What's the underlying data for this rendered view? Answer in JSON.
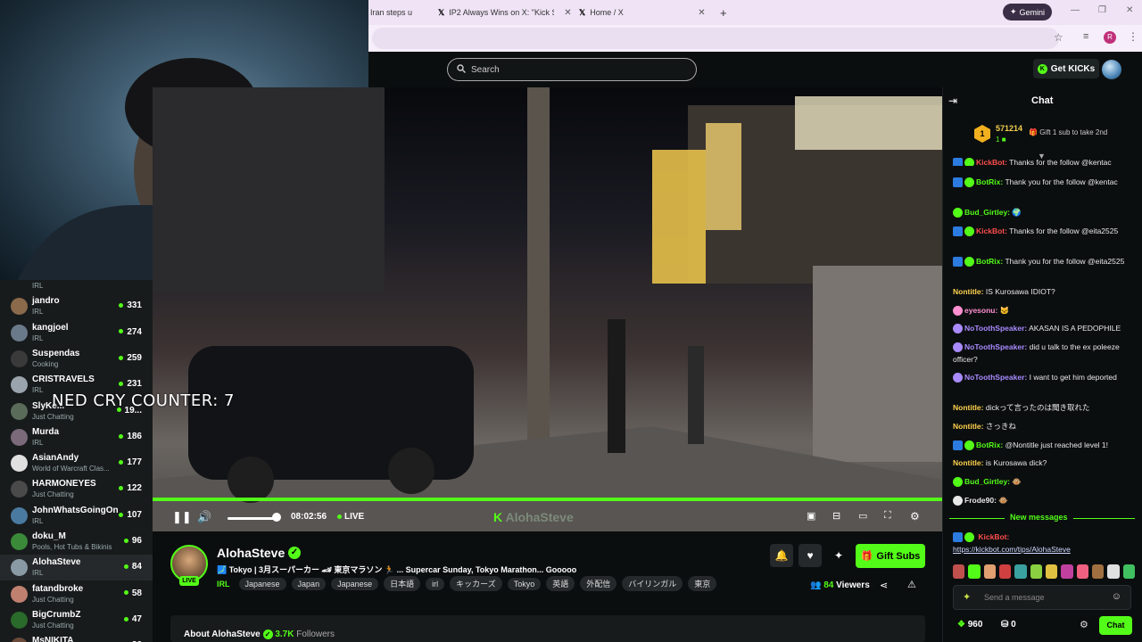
{
  "browser": {
    "tabs": [
      {
        "label": "Iran steps u"
      },
      {
        "label": "IP2 Always Wins on X: \"Kick Stre"
      },
      {
        "label": "Home / X"
      }
    ],
    "gemini_label": "Gemini",
    "profile_initial": "R"
  },
  "header": {
    "search_placeholder": "Search",
    "get_kicks_label": "Get KICKs"
  },
  "overlay": {
    "counter_text": "NED CRY COUNTER: 7"
  },
  "player": {
    "time": "08:02:56",
    "live_label": "LIVE",
    "watermark": "AlohaSteve",
    "progress_fraction": 1.0
  },
  "sidebar": {
    "channels": [
      {
        "name": "",
        "category": "IRL",
        "viewers": ""
      },
      {
        "name": "jandro",
        "category": "IRL",
        "viewers": "331",
        "color": "#8a6a4a"
      },
      {
        "name": "kangjoel",
        "category": "IRL",
        "viewers": "274",
        "color": "#6a7a8a"
      },
      {
        "name": "Suspendas",
        "category": "Cooking",
        "viewers": "259",
        "color": "#3a3a3a"
      },
      {
        "name": "CRISTRAVELS",
        "category": "IRL",
        "viewers": "231",
        "color": "#9aa4ad"
      },
      {
        "name": "SlyKe...",
        "category": "Just Chatting",
        "viewers": "19...",
        "color": "#5b6b5a"
      },
      {
        "name": "Murda",
        "category": "IRL",
        "viewers": "186",
        "color": "#7a6a7a"
      },
      {
        "name": "AsianAndy",
        "category": "World of Warcraft Clas...",
        "viewers": "177",
        "color": "#e0e0e0"
      },
      {
        "name": "HARMONEYES",
        "category": "Just Chatting",
        "viewers": "122",
        "color": "#4a4a4a"
      },
      {
        "name": "JohnWhatsGoingOn",
        "category": "IRL",
        "viewers": "107",
        "color": "#4a7aa0"
      },
      {
        "name": "doku_M",
        "category": "Pools, Hot Tubs & Bikinis",
        "viewers": "96",
        "color": "#3a8a3a"
      },
      {
        "name": "AlohaSteve",
        "category": "IRL",
        "viewers": "84",
        "color": "#8a9aa4"
      },
      {
        "name": "fatandbroke",
        "category": "Just Chatting",
        "viewers": "58",
        "color": "#c08070"
      },
      {
        "name": "BigCrumbZ",
        "category": "Just Chatting",
        "viewers": "47",
        "color": "#2a6a2a"
      },
      {
        "name": "MsNIKITA",
        "category": "",
        "viewers": "36",
        "color": "#6a4a3a"
      }
    ]
  },
  "stream": {
    "streamer": "AlohaSteve",
    "live_badge": "LIVE",
    "title": "🗾 Tokyo | 3月スーパーカー 🏎 東京マラソン 🏃 ... Supercar Sunday, Tokyo Marathon... Gooooo",
    "category": "IRL",
    "tags": [
      "Japanese",
      "Japan",
      "Japanese",
      "日本語",
      "irl",
      "キッカーズ",
      "Tokyo",
      "英語",
      "外配信",
      "バイリンガル",
      "東京"
    ],
    "viewers_count": "84",
    "viewers_label": "Viewers",
    "gift_subs_label": "Gift Subs",
    "about_label": "About AlohaSteve",
    "followers_count": "3.7K",
    "followers_label": "Followers"
  },
  "chat": {
    "title": "Chat",
    "pinned_gifter_count": "571214",
    "pinned_gifter_sub": "1",
    "gift_prompt": "Gift 1 sub to take 2nd",
    "messages": [
      {
        "user": "KickBot:",
        "text": "Thanks for the follow @kentac",
        "color": "#ff4d4d"
      },
      {
        "user": "BotRix:",
        "text": "Thank you for the follow @kentac",
        "color": "#53fc18"
      },
      {
        "user": "Bud_Girtley:",
        "text": "🌍",
        "color": "#53fc18"
      },
      {
        "user": "KickBot:",
        "text": "Thanks for the follow @eita2525",
        "color": "#ff4d4d"
      },
      {
        "user": "BotRix:",
        "text": "Thank you for the follow @eita2525",
        "color": "#53fc18"
      },
      {
        "user": "Nontitle:",
        "text": "IS Kurosawa IDIOT?",
        "color": "#ffd24d"
      },
      {
        "user": "eyesonu:",
        "text": "🐱",
        "color": "#ff8fd1"
      },
      {
        "user": "NoToothSpeaker:",
        "text": "AKASAN IS A PEDOPHILE",
        "color": "#a98bff"
      },
      {
        "user": "NoToothSpeaker:",
        "text": "did u talk to the ex poleeze officer?",
        "color": "#a98bff"
      },
      {
        "user": "NoToothSpeaker:",
        "text": "I want to get him deported",
        "color": "#a98bff"
      },
      {
        "user": "Nontitle:",
        "text": "dickって言ったのは聞き取れた",
        "color": "#ffd24d"
      },
      {
        "user": "Nontitle:",
        "text": "さっきね",
        "color": "#ffd24d"
      },
      {
        "user": "BotRix:",
        "text": "@Nontitle just reached level 1!",
        "color": "#53fc18"
      },
      {
        "user": "Nontitle:",
        "text": "is Kurosawa dick?",
        "color": "#ffd24d"
      },
      {
        "user": "Bud_Girtley:",
        "text": "🐵",
        "color": "#53fc18"
      },
      {
        "user": "Frode90:",
        "text": "🐵",
        "color": "#e8e8e8"
      }
    ],
    "new_messages_label": "New messages",
    "last_user": "KickBot:",
    "last_text": "https://kickbot.com/tips/AlohaSteve",
    "input_placeholder": "Send a message",
    "kicks_count": "960",
    "points_count": "0",
    "chat_button_label": "Chat"
  },
  "colors": {
    "kick_green": "#53fc18",
    "background": "#0b0e0f",
    "panel": "#181b1c"
  }
}
